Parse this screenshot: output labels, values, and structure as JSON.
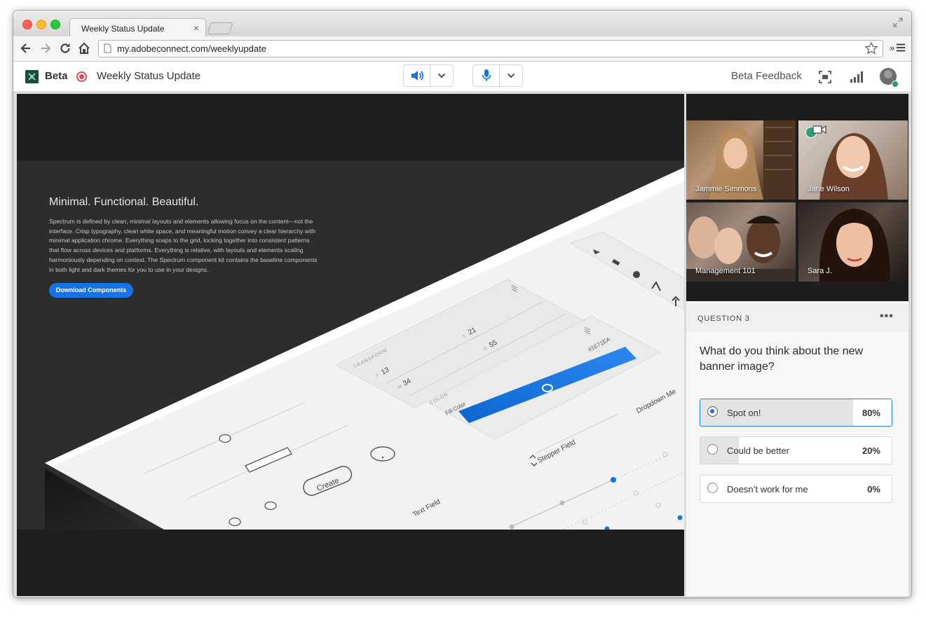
{
  "browser": {
    "tab_title": "Weekly Status Update",
    "tab_close": "×",
    "url": "my.adobeconnect.com/weeklyupdate",
    "ext_chevron": "»"
  },
  "app": {
    "brand": "Beta",
    "meeting_title": "Weekly Status Update",
    "feedback": "Beta Feedback",
    "accent_color": "#1473e6",
    "record_color": "#e34850"
  },
  "slide": {
    "heading": "Minimal. Functional. Beautiful.",
    "body": "Spectrum is defined by clean, minimal layouts and elements allowing focus on the content—not the interface. Crisp typography, clean white space, and meaningful motion convey a clear hierarchy with minimal application chrome. Everything snaps to the grid, locking together into consistent patterns that flow across devices and platforms. Everything is relative, with layouts and elements scaling harmoniously depending on context. The Spectrum component kit contains the baseline components in both light and dark themes for you to use in your designs.",
    "button": "Download Components",
    "ui_labels": {
      "transform": "TRANSFORM",
      "x_label": "X",
      "x_value": "13",
      "y_label": "Y",
      "y_value": "21",
      "w_label": "W",
      "w_value": "34",
      "h_label": "H",
      "h_value": "55",
      "color": "COLOR",
      "fill_color": "Fill Color",
      "hex": "#1E71EA",
      "create": "Create",
      "stepper": "Stepper Field",
      "dropdown": "Dropdown Me",
      "text_field": "Text Field"
    }
  },
  "videos": [
    {
      "name": "Jammie Simmons"
    },
    {
      "name": "Jane Wilson"
    },
    {
      "name": "Management 101"
    },
    {
      "name": "Sara J."
    }
  ],
  "poll": {
    "label": "QUESTION 3",
    "more": "•••",
    "question": "What do you think about the new banner image?",
    "options": [
      {
        "label": "Spot on!",
        "percent_text": "80%",
        "percent": 80,
        "selected": true
      },
      {
        "label": "Could be better",
        "percent_text": "20%",
        "percent": 20,
        "selected": false
      },
      {
        "label": "Doesn’t work for me",
        "percent_text": "0%",
        "percent": 0,
        "selected": false
      }
    ]
  }
}
